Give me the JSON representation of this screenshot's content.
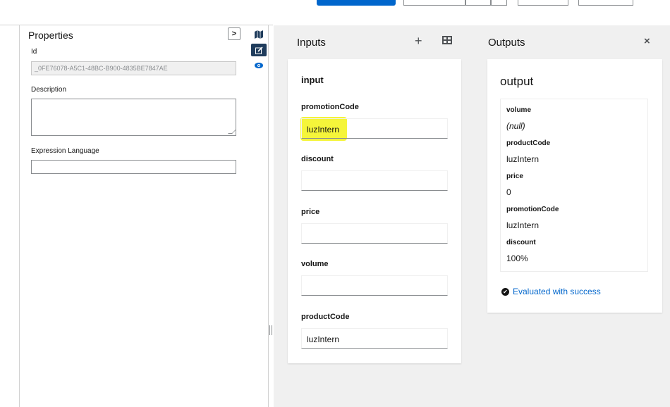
{
  "properties": {
    "title": "Properties",
    "collapse_icon": ">",
    "id_label": "Id",
    "id_value": "_0FE76078-A5C1-48BC-B900-4835BE7847AE",
    "description_label": "Description",
    "description_value": "",
    "expression_label": "Expression Language",
    "expression_value": ""
  },
  "rail": {
    "icons": [
      "map-icon",
      "edit-icon",
      "eye-icon"
    ]
  },
  "inputs": {
    "title": "Inputs",
    "add_icon": "+",
    "card_title": "input",
    "fields": [
      {
        "label": "promotionCode",
        "value": "luzIntern"
      },
      {
        "label": "discount",
        "value": ""
      },
      {
        "label": "price",
        "value": ""
      },
      {
        "label": "volume",
        "value": ""
      },
      {
        "label": "productCode",
        "value": "luzIntern"
      }
    ]
  },
  "outputs": {
    "title": "Outputs",
    "close_icon": "×",
    "card_title": "output",
    "rows": [
      {
        "key": "volume",
        "value": "(null)"
      },
      {
        "key": "productCode",
        "value": "luzIntern"
      },
      {
        "key": "price",
        "value": "0"
      },
      {
        "key": "promotionCode",
        "value": "luzIntern"
      },
      {
        "key": "discount",
        "value": "100%"
      }
    ],
    "status": "Evaluated with success",
    "check_icon": "✔"
  },
  "colors": {
    "accent": "#0066cc",
    "highlight": "#ffff33",
    "rail_active": "#1f3c5c"
  }
}
